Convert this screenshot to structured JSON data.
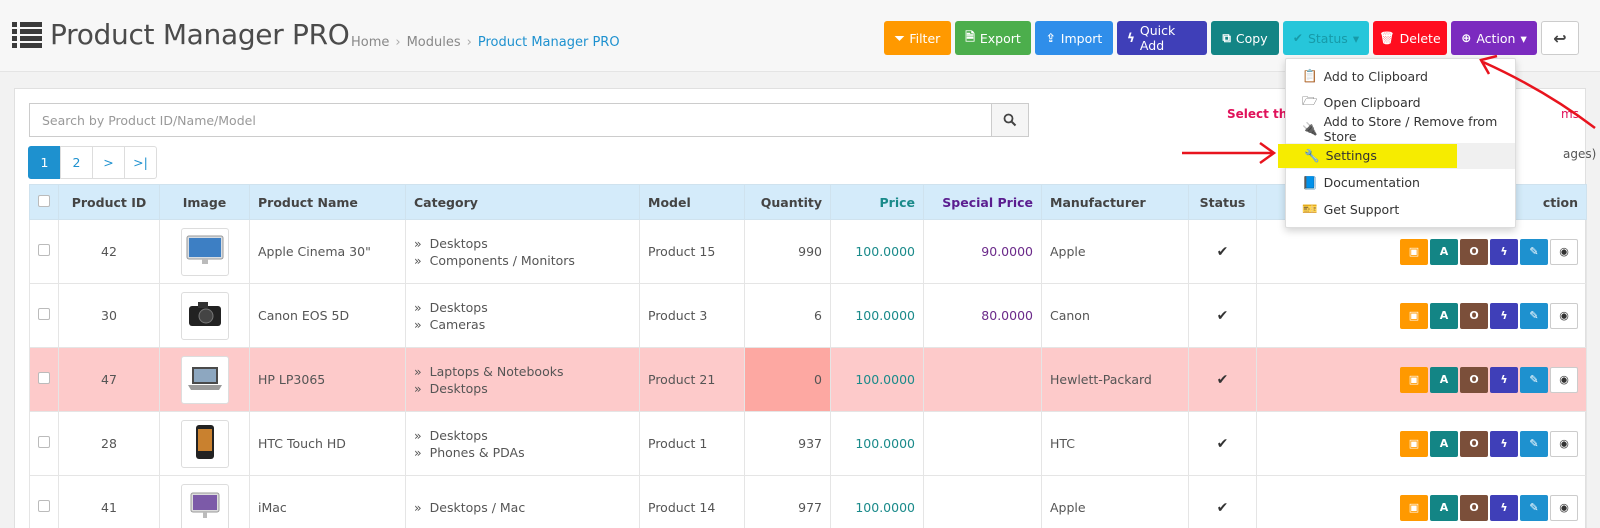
{
  "header": {
    "title": "Product Manager PRO",
    "breadcrumb": [
      "Home",
      "Modules",
      "Product Manager PRO"
    ]
  },
  "toolbar": {
    "filter": "Filter",
    "export": "Export",
    "import": "Import",
    "quick_add": "Quick Add",
    "copy": "Copy",
    "status": "Status",
    "delete": "Delete",
    "action": "Action"
  },
  "search": {
    "placeholder": "Search by Product ID/Name/Model"
  },
  "hint": {
    "text": "Select this chec",
    "tail": "ms",
    "pages": "ages)"
  },
  "pagination": [
    "1",
    "2",
    ">",
    ">|"
  ],
  "table": {
    "headers": [
      "Product ID",
      "Image",
      "Product Name",
      "Category",
      "Model",
      "Quantity",
      "Price",
      "Special Price",
      "Manufacturer",
      "Status",
      "Action"
    ],
    "action_header_partial": "ction",
    "rows": [
      {
        "id": "42",
        "name": "Apple Cinema 30\"",
        "categories": [
          "Desktops",
          "Components / Monitors"
        ],
        "model": "Product 15",
        "quantity": "990",
        "price": "100.0000",
        "special": "90.0000",
        "manufacturer": "Apple",
        "image": "monitor-image"
      },
      {
        "id": "30",
        "name": "Canon EOS 5D",
        "categories": [
          "Desktops",
          "Cameras"
        ],
        "model": "Product 3",
        "quantity": "6",
        "price": "100.0000",
        "special": "80.0000",
        "manufacturer": "Canon",
        "image": "camera-image"
      },
      {
        "id": "47",
        "name": "HP LP3065",
        "categories": [
          "Laptops & Notebooks",
          "Desktops"
        ],
        "model": "Product 21",
        "quantity": "0",
        "price": "100.0000",
        "special": "",
        "manufacturer": "Hewlett-Packard",
        "image": "laptop-image"
      },
      {
        "id": "28",
        "name": "HTC Touch HD",
        "categories": [
          "Desktops",
          "Phones & PDAs"
        ],
        "model": "Product 1",
        "quantity": "937",
        "price": "100.0000",
        "special": "",
        "manufacturer": "HTC",
        "image": "phone-image"
      },
      {
        "id": "41",
        "name": "iMac",
        "categories": [
          "Desktops / Mac"
        ],
        "model": "Product 14",
        "quantity": "977",
        "price": "100.0000",
        "special": "",
        "manufacturer": "Apple",
        "image": "imac-image"
      }
    ],
    "row_action_labels": [
      "A",
      "O"
    ]
  },
  "dropdown": {
    "items": [
      {
        "label": "Add to Clipboard",
        "icon": "clipboard-icon"
      },
      {
        "label": "Open Clipboard",
        "icon": "folder-open-icon"
      },
      {
        "label": "Add to Store / Remove from Store",
        "icon": "plug-icon"
      },
      {
        "label": "Settings",
        "icon": "wrench-icon"
      },
      {
        "label": "Documentation",
        "icon": "book-icon"
      },
      {
        "label": "Get Support",
        "icon": "ticket-icon"
      }
    ]
  },
  "colors": {
    "filter": "#ff9900",
    "export": "#4cae4c",
    "import": "#2f8eea",
    "quick_add": "#3f3fb8",
    "copy": "#138585",
    "status": "#26c6da",
    "delete": "#ff0d1f",
    "action": "#7b2bbf",
    "annotation_arrow": "#e8141e"
  }
}
